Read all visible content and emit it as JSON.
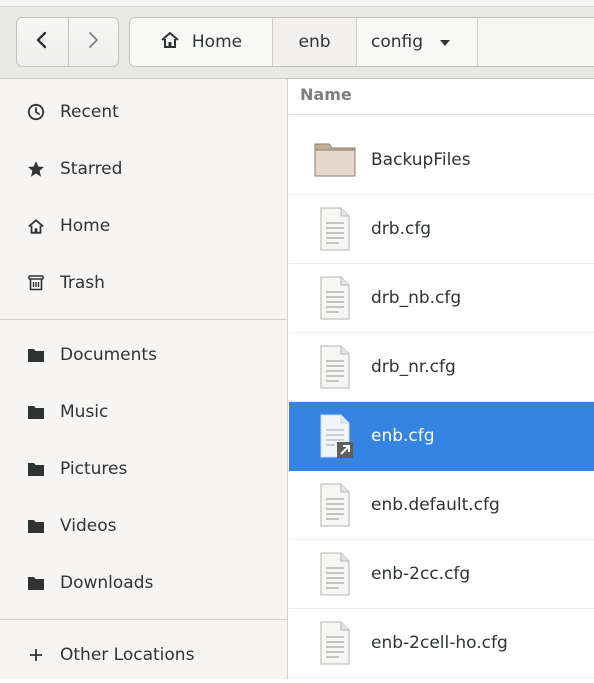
{
  "toolbar": {
    "back_icon": "chevron-left-icon",
    "forward_icon": "chevron-right-icon",
    "breadcrumbs": [
      {
        "label": "Home",
        "icon": "home-icon"
      },
      {
        "label": "enb"
      },
      {
        "label": "config",
        "icon": "chevron-down-icon"
      }
    ]
  },
  "sidebar": {
    "items": [
      {
        "label": "Recent",
        "icon": "clock-icon"
      },
      {
        "label": "Starred",
        "icon": "star-icon"
      },
      {
        "label": "Home",
        "icon": "home-icon"
      },
      {
        "label": "Trash",
        "icon": "trash-icon"
      },
      {
        "label": "Documents",
        "icon": "folder-icon"
      },
      {
        "label": "Music",
        "icon": "folder-icon"
      },
      {
        "label": "Pictures",
        "icon": "folder-icon"
      },
      {
        "label": "Videos",
        "icon": "folder-icon"
      },
      {
        "label": "Downloads",
        "icon": "folder-icon"
      },
      {
        "label": "Other Locations",
        "icon": "plus-icon"
      }
    ]
  },
  "files": {
    "column_name": "Name",
    "items": [
      {
        "name": "BackupFiles",
        "type": "folder"
      },
      {
        "name": "drb.cfg",
        "type": "text-file"
      },
      {
        "name": "drb_nb.cfg",
        "type": "text-file"
      },
      {
        "name": "drb_nr.cfg",
        "type": "text-file"
      },
      {
        "name": "enb.cfg",
        "type": "symlink-text-file",
        "selected": true
      },
      {
        "name": "enb.default.cfg",
        "type": "text-file"
      },
      {
        "name": "enb-2cc.cfg",
        "type": "text-file"
      },
      {
        "name": "enb-2cell-ho.cfg",
        "type": "text-file"
      }
    ]
  },
  "colors": {
    "selection": "#3584e4",
    "sidebar_bg": "#f6f5f4",
    "header_bg": "#e8e8e7"
  }
}
